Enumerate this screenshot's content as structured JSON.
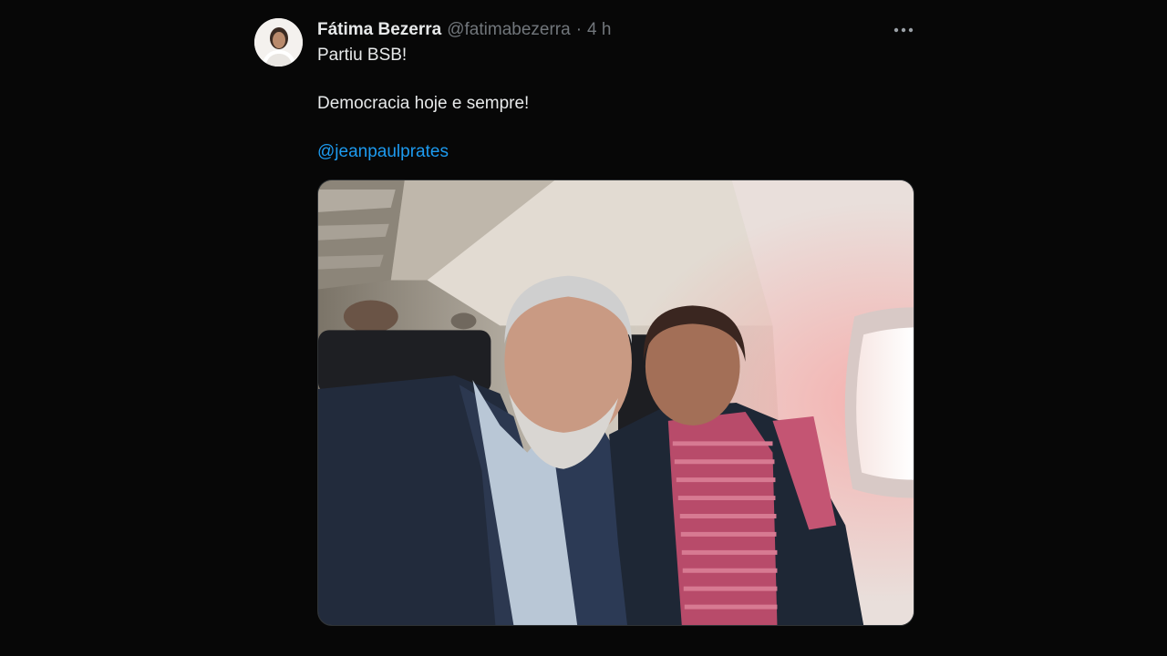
{
  "tweet": {
    "author_name": "Fátima Bezerra",
    "author_handle": "@fatimabezerra",
    "separator": "·",
    "timestamp": "4 h",
    "more_icon": "more-horizontal-icon",
    "lines": {
      "line1": "Partiu BSB!",
      "line2": "Democracia hoje e sempre!",
      "mention": "@jeanpaulprates"
    }
  },
  "colors": {
    "background": "#070707",
    "text": "#e7e9ea",
    "secondary_text": "#71767b",
    "link": "#1d9bf0"
  }
}
